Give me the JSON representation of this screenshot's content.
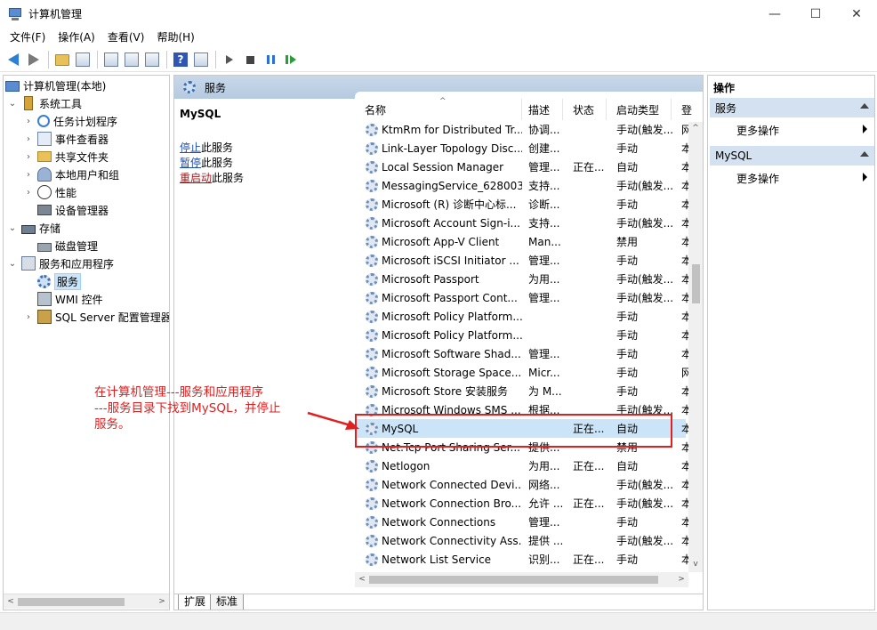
{
  "window": {
    "title": "计算机管理",
    "controls": {
      "minimize": "—",
      "maximize": "☐",
      "close": "✕"
    }
  },
  "menu": [
    "文件(F)",
    "操作(A)",
    "查看(V)",
    "帮助(H)"
  ],
  "tree": {
    "root": "计算机管理(本地)",
    "system_tools": "系统工具",
    "task_scheduler": "任务计划程序",
    "event_viewer": "事件查看器",
    "shared_folders": "共享文件夹",
    "local_users": "本地用户和组",
    "performance": "性能",
    "device_manager": "设备管理器",
    "storage": "存储",
    "disk_management": "磁盘管理",
    "services_apps": "服务和应用程序",
    "services": "服务",
    "wmi": "WMI 控件",
    "sql_config": "SQL Server 配置管理器"
  },
  "middle": {
    "header": "服务",
    "selected_service": "MySQL",
    "actions": [
      {
        "link": "停止",
        "suffix": "此服务"
      },
      {
        "link": "暂停",
        "suffix": "此服务"
      },
      {
        "link": "重启动",
        "suffix": "此服务"
      }
    ],
    "columns": {
      "name": "名称",
      "desc": "描述",
      "status": "状态",
      "startup": "启动类型",
      "logon": "登"
    },
    "rows": [
      {
        "name": "KtmRm for Distributed Tr...",
        "desc": "协调...",
        "status": "",
        "startup": "手动(触发...",
        "logon": "网"
      },
      {
        "name": "Link-Layer Topology Disc...",
        "desc": "创建...",
        "status": "",
        "startup": "手动",
        "logon": "本"
      },
      {
        "name": "Local Session Manager",
        "desc": "管理...",
        "status": "正在...",
        "startup": "自动",
        "logon": "本"
      },
      {
        "name": "MessagingService_628003",
        "desc": "支持...",
        "status": "",
        "startup": "手动(触发...",
        "logon": "本"
      },
      {
        "name": "Microsoft (R) 诊断中心标...",
        "desc": "诊断...",
        "status": "",
        "startup": "手动",
        "logon": "本"
      },
      {
        "name": "Microsoft Account Sign-i...",
        "desc": "支持...",
        "status": "",
        "startup": "手动(触发...",
        "logon": "本"
      },
      {
        "name": "Microsoft App-V Client",
        "desc": "Man...",
        "status": "",
        "startup": "禁用",
        "logon": "本"
      },
      {
        "name": "Microsoft iSCSI Initiator ...",
        "desc": "管理...",
        "status": "",
        "startup": "手动",
        "logon": "本"
      },
      {
        "name": "Microsoft Passport",
        "desc": "为用...",
        "status": "",
        "startup": "手动(触发...",
        "logon": "本"
      },
      {
        "name": "Microsoft Passport Cont...",
        "desc": "管理...",
        "status": "",
        "startup": "手动(触发...",
        "logon": "本"
      },
      {
        "name": "Microsoft Policy Platform...",
        "desc": "",
        "status": "",
        "startup": "手动",
        "logon": "本"
      },
      {
        "name": "Microsoft Policy Platform...",
        "desc": "",
        "status": "",
        "startup": "手动",
        "logon": "本"
      },
      {
        "name": "Microsoft Software Shad...",
        "desc": "管理...",
        "status": "",
        "startup": "手动",
        "logon": "本"
      },
      {
        "name": "Microsoft Storage Space...",
        "desc": "Micr...",
        "status": "",
        "startup": "手动",
        "logon": "网"
      },
      {
        "name": "Microsoft Store 安装服务",
        "desc": "为 M...",
        "status": "",
        "startup": "手动",
        "logon": "本"
      },
      {
        "name": "Microsoft Windows SMS ...",
        "desc": "根据...",
        "status": "",
        "startup": "手动(触发...",
        "logon": "本"
      },
      {
        "name": "MySQL",
        "desc": "",
        "status": "正在...",
        "startup": "自动",
        "logon": "本"
      },
      {
        "name": "Net.Tcp Port Sharing Ser...",
        "desc": "提供...",
        "status": "",
        "startup": "禁用",
        "logon": "本"
      },
      {
        "name": "Netlogon",
        "desc": "为用...",
        "status": "正在...",
        "startup": "自动",
        "logon": "本"
      },
      {
        "name": "Network Connected Devi...",
        "desc": "网络...",
        "status": "",
        "startup": "手动(触发...",
        "logon": "本"
      },
      {
        "name": "Network Connection Bro...",
        "desc": "允许 ...",
        "status": "正在...",
        "startup": "手动(触发...",
        "logon": "本"
      },
      {
        "name": "Network Connections",
        "desc": "管理...",
        "status": "",
        "startup": "手动",
        "logon": "本"
      },
      {
        "name": "Network Connectivity Ass...",
        "desc": "提供 ...",
        "status": "",
        "startup": "手动(触发...",
        "logon": "本"
      },
      {
        "name": "Network List Service",
        "desc": "识别...",
        "status": "正在...",
        "startup": "手动",
        "logon": "本"
      }
    ],
    "tabs": [
      "扩展",
      "标准"
    ]
  },
  "actions_pane": {
    "title": "操作",
    "section1": "服务",
    "section2": "MySQL",
    "more": "更多操作"
  },
  "annotation": {
    "line1": "在计算机管理---服务和应用程序",
    "line2": "---服务目录下找到MySQL，并停止",
    "line3": "服务。",
    "color": "#e02020"
  }
}
